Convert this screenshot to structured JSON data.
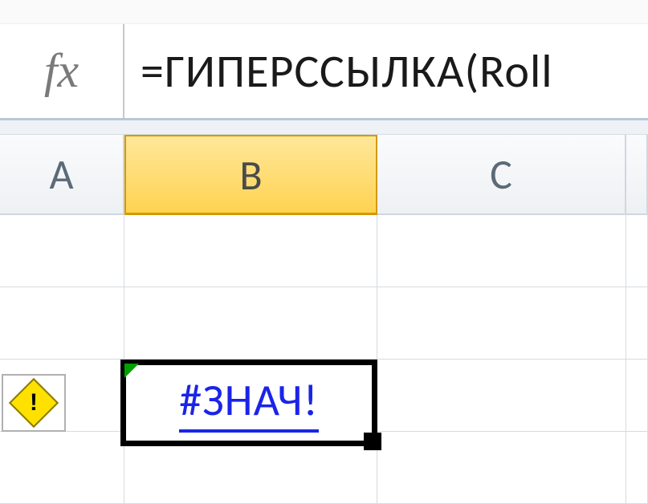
{
  "formula_bar": {
    "fx_label": "fx",
    "formula": "=ГИПЕРССЫЛКА(Roll"
  },
  "columns": {
    "a": "A",
    "b": "B",
    "c": "C",
    "selected": "B"
  },
  "active_cell": {
    "address": "B3",
    "display_value": "#ЗНАЧ!",
    "is_hyperlink_style": true,
    "has_error": true
  },
  "smart_tag": {
    "icon": "warning-diamond",
    "glyph": "!"
  }
}
